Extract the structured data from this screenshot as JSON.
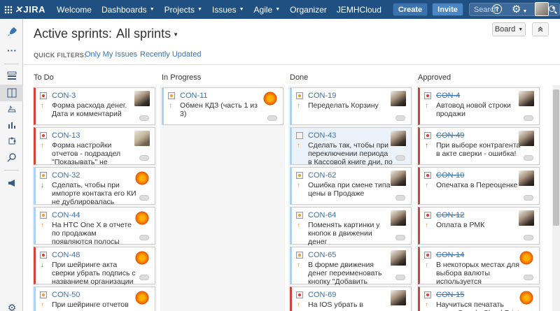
{
  "nav": {
    "logo_text": "JIRA",
    "items": [
      {
        "label": "Welcome",
        "caret": false
      },
      {
        "label": "Dashboards",
        "caret": true
      },
      {
        "label": "Projects",
        "caret": true
      },
      {
        "label": "Issues",
        "caret": true
      },
      {
        "label": "Agile",
        "caret": true
      },
      {
        "label": "Organizer",
        "caret": false
      },
      {
        "label": "JEMHCloud",
        "caret": false
      }
    ],
    "create_label": "Create",
    "invite_label": "Invite",
    "search_placeholder": "Search",
    "help_label": "?"
  },
  "header": {
    "title": "Active sprints:",
    "selector": "All sprints",
    "board_button": "Board",
    "quick_filters_label": "QUICK FILTERS:",
    "quick_filters": [
      "Only My Issues",
      "Recently Updated"
    ]
  },
  "columns": [
    {
      "title": "To Do",
      "cards": [
        {
          "key": "CON-3",
          "summary": "Форма расхода денег. Дата и комментарий",
          "border": "red",
          "type": "bug",
          "priority": "up-o",
          "avatar": "photo",
          "done": false
        },
        {
          "key": "CON-13",
          "summary": "Форма настройки отчетов - подраздел \"Показывать\" не очевиден, подумать как",
          "border": "red",
          "type": "bug",
          "priority": "up-o",
          "avatar": "photo2",
          "done": false
        },
        {
          "key": "CON-32",
          "summary": "Сделать, чтобы при импорте контакта его КИ не дублировалась",
          "border": "blue",
          "type": "story",
          "priority": "down",
          "avatar": "flower",
          "done": false
        },
        {
          "key": "CON-44",
          "summary": "На HTC One X в отчете по продажам появляются полосы прокрутки",
          "border": "blue",
          "type": "story",
          "priority": "up-o",
          "avatar": "flower",
          "done": false
        },
        {
          "key": "CON-48",
          "summary": "При шейринге акта сверки убрать подпись с названием организации",
          "border": "red",
          "type": "bug",
          "priority": "down",
          "avatar": "flower",
          "done": false
        },
        {
          "key": "CON-50",
          "summary": "При шейринге отчетов валюту отчета писать не в скобках, а через запятую",
          "border": "blue",
          "type": "story",
          "priority": "up-o",
          "avatar": "flower",
          "done": false
        }
      ]
    },
    {
      "title": "In Progress",
      "cards": [
        {
          "key": "CON-11",
          "summary": "Обмен КДЗ (часть 1 из 3)",
          "border": "blue",
          "type": "story",
          "priority": "up-o",
          "avatar": "flower",
          "done": false
        }
      ]
    },
    {
      "title": "Done",
      "cards": [
        {
          "key": "CON-19",
          "summary": "Переделать Корзину",
          "border": "blue",
          "type": "story",
          "priority": "up-o",
          "avatar": "photo",
          "done": false
        },
        {
          "key": "CON-43",
          "summary": "Сделать так, чтобы при переключении периода в Кассовой книге дни, по",
          "border": "blue",
          "type": "bug",
          "priority": "up-o",
          "avatar": "photo",
          "done": false,
          "selected": true
        },
        {
          "key": "CON-62",
          "summary": "Ошибка при смене типа цены в Продаже",
          "border": "blue",
          "type": "story",
          "priority": "up-o",
          "avatar": "photo",
          "done": false
        },
        {
          "key": "CON-64",
          "summary": "Поменять картинки у кнопок в движении денег",
          "border": "blue",
          "type": "story",
          "priority": "up-o",
          "avatar": "photo",
          "done": false
        },
        {
          "key": "CON-65",
          "summary": "В форме движения денег переименовать кнопку \"Добавить валюту\" на",
          "border": "blue",
          "type": "story",
          "priority": "up-o",
          "avatar": "photo",
          "done": false
        },
        {
          "key": "CON-69",
          "summary": "На IOS убрать в заголовке контрагента возможность перехода на контакт",
          "border": "red",
          "type": "bug",
          "priority": "up-o",
          "avatar": "photo",
          "done": false
        }
      ]
    },
    {
      "title": "Approved",
      "cards": [
        {
          "key": "CON-4",
          "summary": "Автовод новой строки продажи",
          "border": "red",
          "type": "bug",
          "priority": "up-o",
          "avatar": "photo",
          "done": true
        },
        {
          "key": "CON-49",
          "summary": "При выборе контрагента в акте сверки - ошибка!",
          "border": "red",
          "type": "bug",
          "priority": "up-r",
          "avatar": "photo",
          "done": true
        },
        {
          "key": "CON-10",
          "summary": "Опечатка в Переоценке",
          "border": "red",
          "type": "bug",
          "priority": "up-o",
          "avatar": "photo",
          "done": true
        },
        {
          "key": "CON-12",
          "summary": "Оплата в РМК",
          "border": "red",
          "type": "bug",
          "priority": "up-o",
          "avatar": "photo",
          "done": true
        },
        {
          "key": "CON-14",
          "summary": "В некоторых местах для выбора валюты используется выпадающий список, а",
          "border": "red",
          "type": "bug",
          "priority": "up-o",
          "avatar": "flower",
          "done": true
        },
        {
          "key": "CON-15",
          "summary": "Научиться печатать через Google Cloud Print",
          "border": "red",
          "type": "bug",
          "priority": "up-o",
          "avatar": "flower",
          "done": true
        }
      ]
    }
  ],
  "colors": {
    "nav_bg": "#205081",
    "link": "#3b73af",
    "bug": "#d04437",
    "story_border": "#aed3f2"
  }
}
